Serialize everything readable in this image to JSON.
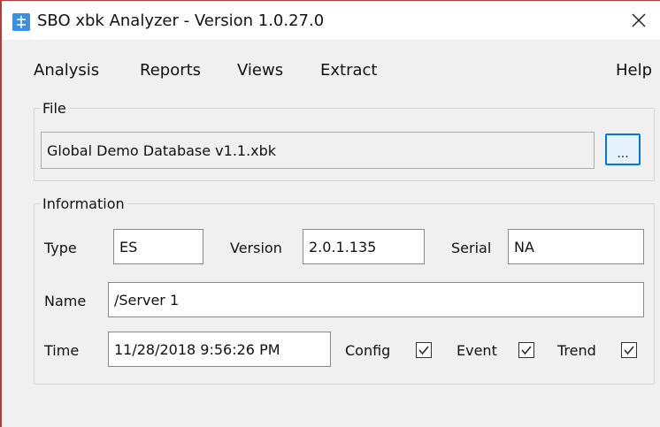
{
  "window": {
    "title": "SBO xbk Analyzer - Version 1.0.27.0",
    "close_glyph": "✕",
    "accent": "#3a8ee6",
    "app_icon": "app-icon"
  },
  "menu": {
    "analysis": "Analysis",
    "reports": "Reports",
    "views": "Views",
    "extract": "Extract",
    "help": "Help"
  },
  "file_group": {
    "legend": "File",
    "path": "Global Demo Database v1.1.xbk",
    "browse_label": "..."
  },
  "info_group": {
    "legend": "Information",
    "type_label": "Type",
    "type_value": "ES",
    "version_label": "Version",
    "version_value": "2.0.1.135",
    "serial_label": "Serial",
    "serial_value": "NA",
    "name_label": "Name",
    "name_value": "/Server 1",
    "time_label": "Time",
    "time_value": "11/28/2018 9:56:26 PM",
    "config_label": "Config",
    "config_checked": true,
    "event_label": "Event",
    "event_checked": true,
    "trend_label": "Trend",
    "trend_checked": true
  }
}
